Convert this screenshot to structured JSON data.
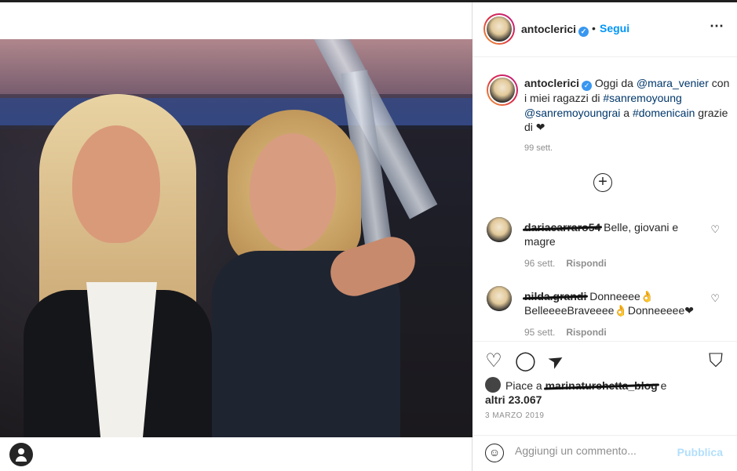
{
  "post": {
    "username": "antoclerici",
    "dot": "•",
    "follow_label": "Segui",
    "more_icon": "⋯"
  },
  "caption": {
    "username": "antoclerici",
    "text_before": " Oggi da ",
    "mention1": "@mara_venier",
    "text_mid": " con i miei ragazzi di ",
    "hashtag1": "#sanremoyoung",
    "mention2": "@sanremoyoungrai",
    "text_a": " a ",
    "hashtag2": "#domenicain",
    "text_end": " grazie di ❤",
    "time": "99 sett."
  },
  "load_more_icon": "+",
  "comments": [
    {
      "username": "dariacarraro54",
      "text": " Belle, giovani e magre",
      "time": "96 sett.",
      "reply_label": "Rispondi"
    },
    {
      "username": "nilda.grandi",
      "text": " Donneeee👌 BelleeeeBraveeee👌Donneeeee❤",
      "time": "95 sett.",
      "reply_label": "Rispondi"
    }
  ],
  "likes": {
    "prefix": "Piace a ",
    "liker": "marinaturchetta_blog",
    "suffix": " e",
    "others": "altri 23.067"
  },
  "date": "3 MARZO 2019",
  "add_comment": {
    "placeholder": "Aggiungi un commento...",
    "publish_label": "Pubblica",
    "emoji_icon": "☺"
  },
  "icons": {
    "heart": "♡",
    "comment": "◯",
    "share": "➤",
    "save": "⛉"
  },
  "colors": {
    "link": "#00376b",
    "follow": "#0095f6",
    "verified": "#3897f0",
    "muted": "#8e8e8e",
    "publish_disabled": "#b2dffc"
  }
}
